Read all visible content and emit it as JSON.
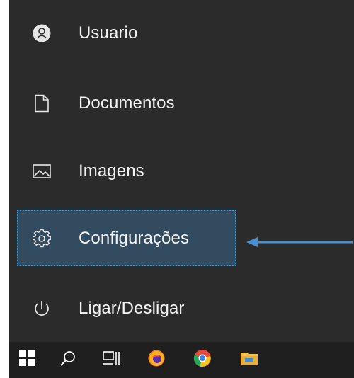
{
  "menu": {
    "items": [
      {
        "label": "Usuario",
        "icon": "user-avatar-icon"
      },
      {
        "label": "Documentos",
        "icon": "document-icon"
      },
      {
        "label": "Imagens",
        "icon": "pictures-icon"
      },
      {
        "label": "Configurações",
        "icon": "gear-icon"
      },
      {
        "label": "Ligar/Desligar",
        "icon": "power-icon"
      }
    ],
    "highlighted": "Configurações"
  },
  "taskbar": {
    "items": [
      {
        "name": "start-button",
        "icon": "windows-logo-icon"
      },
      {
        "name": "search-button",
        "icon": "search-icon"
      },
      {
        "name": "task-view-button",
        "icon": "task-view-icon"
      },
      {
        "name": "firefox-button",
        "icon": "firefox-icon"
      },
      {
        "name": "chrome-button",
        "icon": "chrome-icon"
      },
      {
        "name": "file-explorer-button",
        "icon": "folder-icon"
      }
    ]
  },
  "colors": {
    "menu_bg": "#2b2b2b",
    "taskbar_bg": "#1f1f1f",
    "highlight_bg": "#324b5e",
    "highlight_border": "#3aa0e6",
    "arrow": "#4a90d0",
    "text": "#f2f2f2"
  }
}
